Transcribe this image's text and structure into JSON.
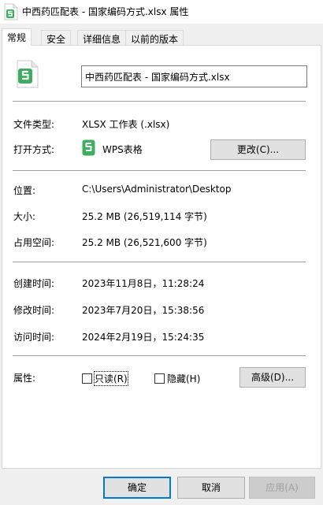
{
  "window": {
    "title": "中西药匹配表 - 国家编码方式.xlsx 属性"
  },
  "tabs": [
    {
      "label": "常规",
      "active": true
    },
    {
      "label": "安全",
      "active": false
    },
    {
      "label": "详细信息",
      "active": false
    },
    {
      "label": "以前的版本",
      "active": false
    }
  ],
  "general": {
    "file_name": "中西药匹配表 - 国家编码方式.xlsx",
    "file_type_label": "文件类型:",
    "file_type_value": "XLSX 工作表 (.xlsx)",
    "open_with_label": "打开方式:",
    "open_with_value": "WPS表格",
    "change_button": "更改(C)...",
    "location_label": "位置:",
    "location_value": "C:\\Users\\Administrator\\Desktop",
    "size_label": "大小:",
    "size_value": "25.2 MB (26,519,114 字节)",
    "disk_size_label": "占用空间:",
    "disk_size_value": "25.2 MB (26,521,600 字节)",
    "created_label": "创建时间:",
    "created_value": "2023年11月8日，11:28:24",
    "modified_label": "修改时间:",
    "modified_value": "2023年7月20日，15:38:56",
    "accessed_label": "访问时间:",
    "accessed_value": "2024年2月19日，15:24:35",
    "attributes_label": "属性:",
    "readonly_label": "只读(R)",
    "readonly_checked": false,
    "hidden_label": "隐藏(H)",
    "hidden_checked": false,
    "advanced_button": "高级(D)..."
  },
  "footer": {
    "ok": "确定",
    "cancel": "取消",
    "apply": "应用(A)"
  },
  "colors": {
    "accent": "#0078d7",
    "wps_green": "#3cae5d"
  }
}
